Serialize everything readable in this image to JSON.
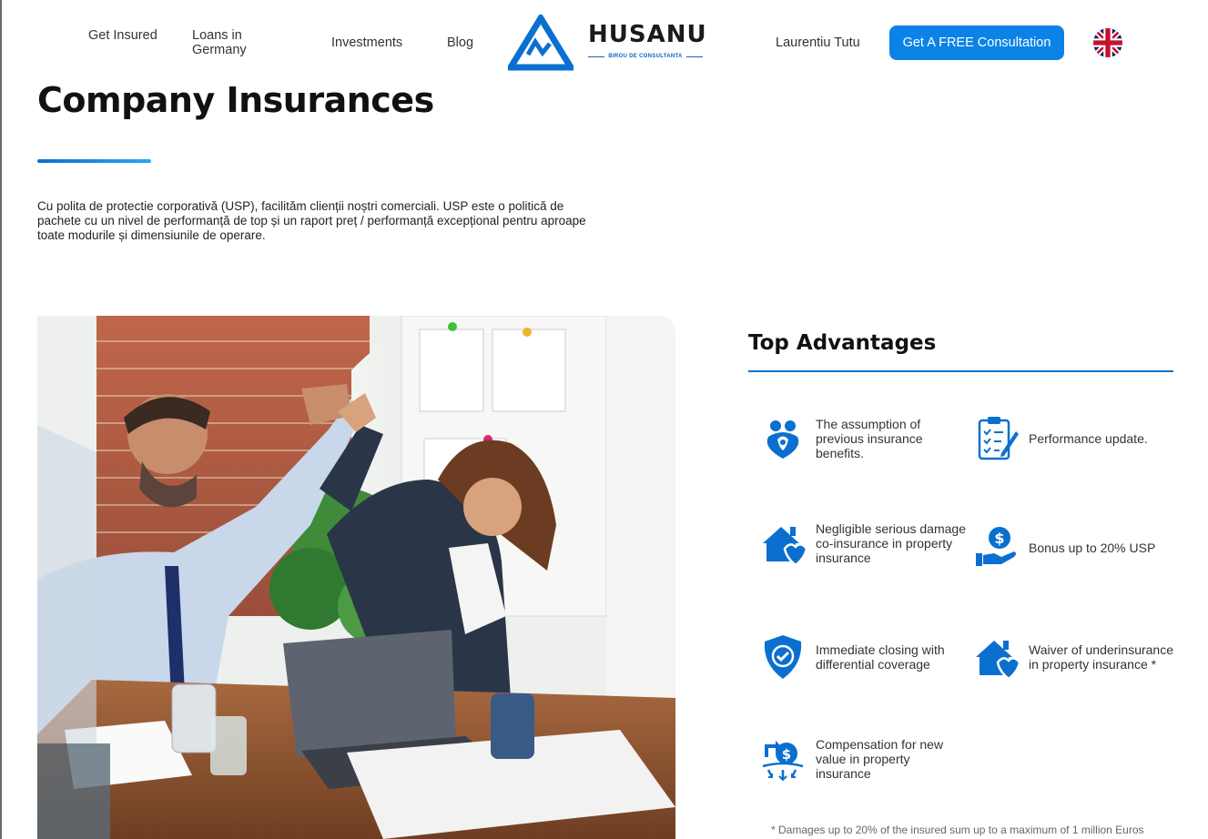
{
  "header": {
    "nav": {
      "get_insured": "Get Insured",
      "loans": "Loans in Germany",
      "investments": "Investments",
      "blog": "Blog",
      "user": "Laurentiu Tutu"
    },
    "logo": {
      "name": "HUSANU",
      "tagline": "BIROU DE CONSULTANTA",
      "icon": "mountain-logo-icon"
    },
    "cta_label": "Get A FREE Consultation",
    "language_icon": "uk-flag-icon"
  },
  "main": {
    "title": "Company Insurances",
    "intro": "Cu polita de protectie corporativă (USP), facilităm clienții noștri comerciali. USP este o politică de pachete cu un nivel de performanță de top și un raport preț / performanță excepțional pentru aproape toate modurile și dimensiunile de operare."
  },
  "advantages": {
    "heading": "Top Advantages",
    "items": [
      {
        "label": "The assumption of previous insurance benefits.",
        "icon": "family-heart-icon"
      },
      {
        "label": "Performance update.",
        "icon": "clipboard-checklist-icon"
      },
      {
        "label": "Negligible serious damage co-insurance in property insurance",
        "icon": "house-heart-icon"
      },
      {
        "label": "Bonus up to 20% USP",
        "icon": "hand-dollar-icon"
      },
      {
        "label": "Immediate closing with differential coverage",
        "icon": "shield-check-icon"
      },
      {
        "label": "Waiver of underinsurance in property insurance *",
        "icon": "house-heart-icon"
      },
      {
        "label": "Compensation for new value in property insurance",
        "icon": "money-cycle-icon"
      }
    ],
    "footnote": "* Damages up to 20% of the insured sum up to a maximum of 1 million Euros"
  },
  "colors": {
    "accent": "#0b83e6",
    "brand_blue": "#0b6fd0"
  }
}
